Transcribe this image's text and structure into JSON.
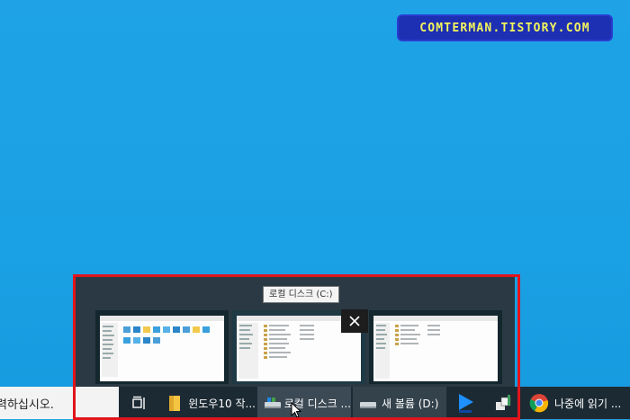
{
  "watermark": "COMTERMAN.TISTORY.COM",
  "tooltip": "로컬 디스크 (C:)",
  "search": {
    "text": "력하십시오."
  },
  "taskbar": {
    "items": [
      {
        "label": "윈도우10 작..."
      },
      {
        "label": "로컬 디스크 ..."
      },
      {
        "label": "새 볼륨 (D:)"
      },
      {
        "label": "나중에 읽기 ..."
      }
    ]
  },
  "icons": {
    "task_view": "task-view-icon",
    "folder": "folder-icon",
    "drive": "drive-icon",
    "media": "media-player-icon",
    "network": "network-icon",
    "chrome": "chrome-icon",
    "close": "close-icon"
  },
  "colors": {
    "desktop": "#1fa3e6",
    "taskbar": "#1c2a33",
    "highlight": "#e2141c",
    "watermark_bg": "#1d2fb3",
    "watermark_text": "#f2f45b"
  }
}
